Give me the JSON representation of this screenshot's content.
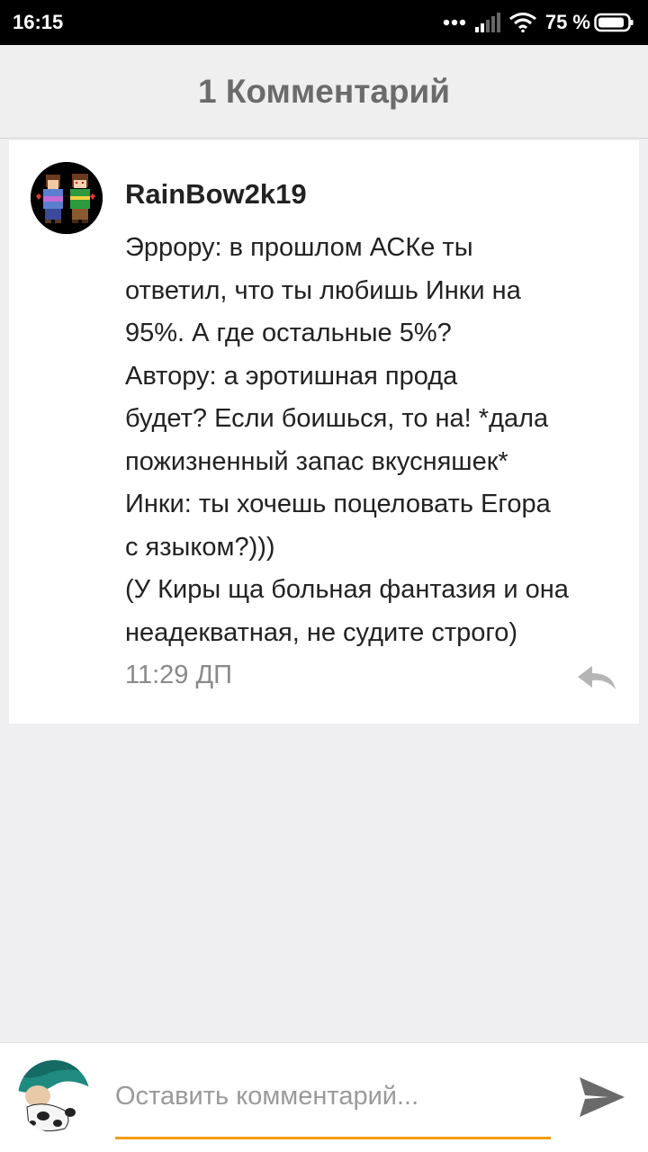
{
  "status_bar": {
    "time": "16:15",
    "battery_percent": "75 %",
    "icons": [
      "dots-icon",
      "signal-icon",
      "wifi-icon",
      "battery-icon"
    ]
  },
  "header": {
    "title": "1 Комментарий"
  },
  "comment": {
    "author": "RainBow2k19",
    "text": "Эррору: в прошлом АСКе ты\nответил, что ты любишь Инки на\n95%. А где остальные 5%?\nАвтору: а эротишная прода\nбудет? Если боишься, то на! *дала\nпожизненный запас вкусняшек*\nИнки: ты хочешь поцеловать Егора\nс языком?)))\n(У Киры ща больная фантазия и она\nнеадекватная, не судите строго)",
    "time": "11:29 ДП"
  },
  "composer": {
    "placeholder": "Оставить комментарий...",
    "value": ""
  },
  "colors": {
    "accent": "#f39c12",
    "header_bg": "#efefef",
    "page_bg": "#efeef1"
  }
}
